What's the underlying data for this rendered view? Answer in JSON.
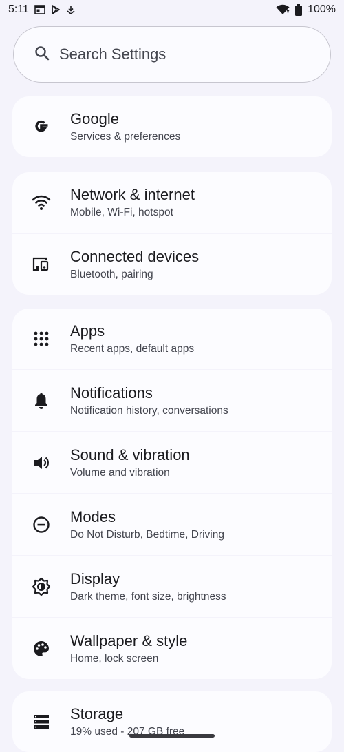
{
  "status": {
    "time": "5:11",
    "battery": "100%",
    "icons": [
      "calendar-icon",
      "play-store-icon",
      "download-icon",
      "wifi-icon",
      "battery-icon"
    ]
  },
  "search": {
    "placeholder": "Search Settings",
    "icon": "search-icon"
  },
  "groups": [
    {
      "items": [
        {
          "icon": "google-icon",
          "title": "Google",
          "subtitle": "Services & preferences"
        }
      ]
    },
    {
      "items": [
        {
          "icon": "wifi-icon",
          "title": "Network & internet",
          "subtitle": "Mobile, Wi‑Fi, hotspot"
        },
        {
          "icon": "connected-devices-icon",
          "title": "Connected devices",
          "subtitle": "Bluetooth, pairing"
        }
      ]
    },
    {
      "items": [
        {
          "icon": "apps-grid-icon",
          "title": "Apps",
          "subtitle": "Recent apps, default apps"
        },
        {
          "icon": "bell-icon",
          "title": "Notifications",
          "subtitle": "Notification history, conversations"
        },
        {
          "icon": "speaker-icon",
          "title": "Sound & vibration",
          "subtitle": "Volume and vibration"
        },
        {
          "icon": "do-not-disturb-icon",
          "title": "Modes",
          "subtitle": "Do Not Disturb, Bedtime, Driving"
        },
        {
          "icon": "brightness-icon",
          "title": "Display",
          "subtitle": "Dark theme, font size, brightness"
        },
        {
          "icon": "palette-icon",
          "title": "Wallpaper & style",
          "subtitle": "Home, lock screen"
        }
      ]
    },
    {
      "items": [
        {
          "icon": "storage-icon",
          "title": "Storage",
          "subtitle": "19% used - 207 GB free"
        }
      ]
    }
  ]
}
